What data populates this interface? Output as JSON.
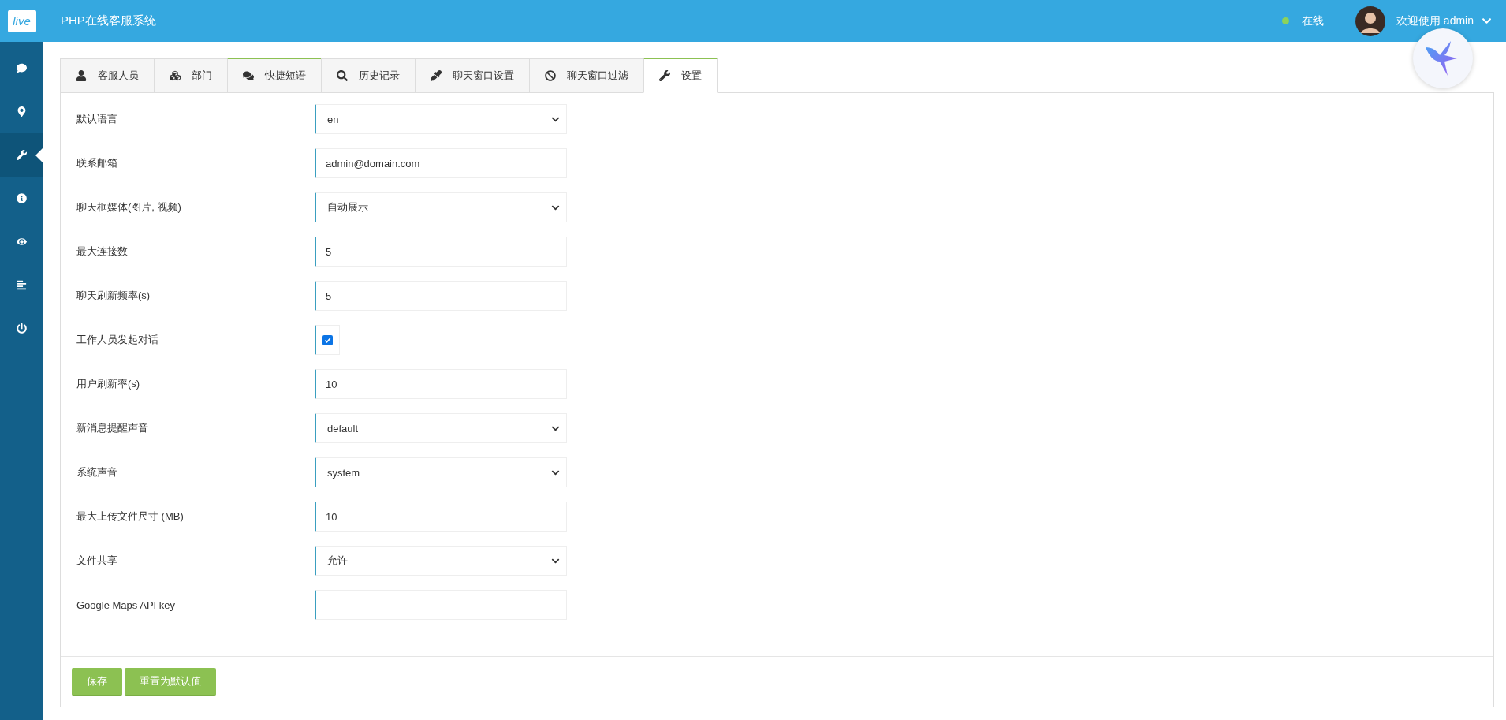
{
  "header": {
    "logo": "live",
    "title": "PHP在线客服系统",
    "status": {
      "label": "在线",
      "online": true
    },
    "user": {
      "greeting": "欢迎使用 admin"
    }
  },
  "sidebar": {
    "items": [
      {
        "selected": false
      },
      {
        "selected": false
      },
      {
        "selected": true
      },
      {
        "selected": false
      },
      {
        "selected": false
      },
      {
        "selected": false
      },
      {
        "selected": false
      }
    ]
  },
  "tabs": [
    {
      "label": "客服人员",
      "selected": false,
      "accent": false
    },
    {
      "label": "部门",
      "selected": false,
      "accent": false
    },
    {
      "label": "快捷短语",
      "selected": false,
      "accent": true
    },
    {
      "label": "历史记录",
      "selected": false,
      "accent": false
    },
    {
      "label": "聊天窗口设置",
      "selected": false,
      "accent": false
    },
    {
      "label": "聊天窗口过滤",
      "selected": false,
      "accent": false
    },
    {
      "label": "设置",
      "selected": true,
      "accent": true
    }
  ],
  "fields": [
    {
      "kind": "select",
      "label": "默认语言",
      "value": "en"
    },
    {
      "kind": "text",
      "label": "联系邮箱",
      "value": "admin@domain.com"
    },
    {
      "kind": "select",
      "label": "聊天框媒体(图片, 视频)",
      "value": "自动展示"
    },
    {
      "kind": "text",
      "label": "最大连接数",
      "value": "5"
    },
    {
      "kind": "text",
      "label": "聊天刷新频率(s)",
      "value": "5"
    },
    {
      "kind": "checkbox",
      "label": "工作人员发起对话",
      "checked": true
    },
    {
      "kind": "text",
      "label": "用户刷新率(s)",
      "value": "10"
    },
    {
      "kind": "select",
      "label": "新消息提醒声音",
      "value": "default"
    },
    {
      "kind": "select",
      "label": "系统声音",
      "value": "system"
    },
    {
      "kind": "text",
      "label": "最大上传文件尺寸 (MB)",
      "value": "10"
    },
    {
      "kind": "select",
      "label": "文件共享",
      "value": "允许"
    },
    {
      "kind": "text",
      "label": "Google Maps API key"
    }
  ],
  "buttons": [
    "保存",
    "重置为默认值"
  ]
}
